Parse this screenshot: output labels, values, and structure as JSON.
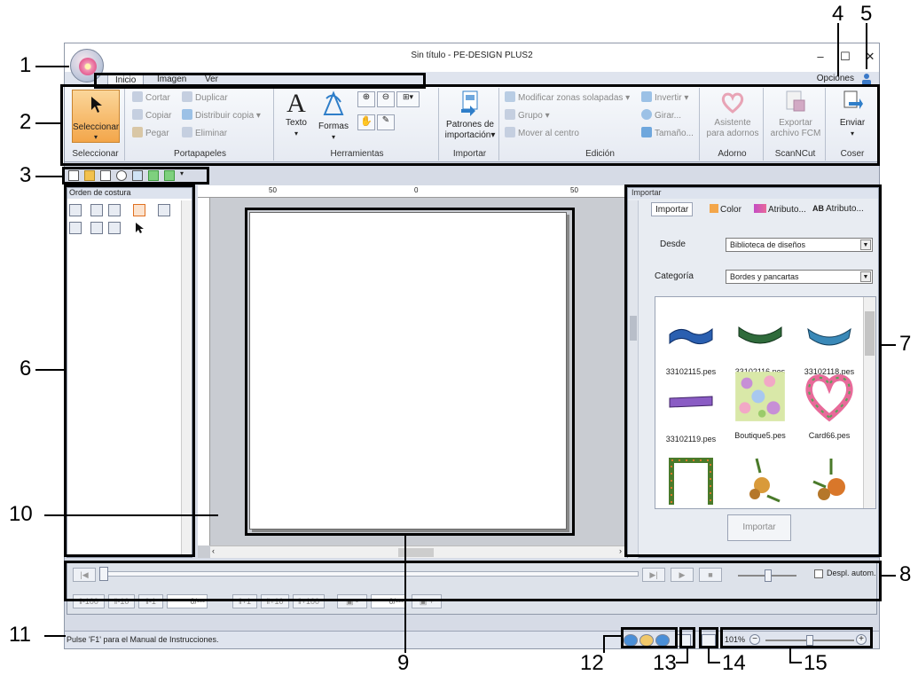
{
  "window": {
    "title": "Sin título - PE-DESIGN PLUS2",
    "min_glyph": "–",
    "max_glyph": "☐",
    "close_glyph": "✕"
  },
  "tabs": [
    {
      "label": "Inicio"
    },
    {
      "label": "Imagen"
    },
    {
      "label": "Ver"
    }
  ],
  "options_label": "Opciones",
  "ribbon": {
    "seleccionar": {
      "button": "Seleccionar",
      "group": "Seleccionar"
    },
    "portapapeles": {
      "group": "Portapapeles",
      "cut": "Cortar",
      "duplicate": "Duplicar",
      "copy": "Copiar",
      "distribute": "Distribuir copia",
      "paste": "Pegar",
      "delete": "Eliminar"
    },
    "herramientas": {
      "group": "Herramientas",
      "text": "Texto",
      "shapes": "Formas"
    },
    "importar": {
      "group": "Importar",
      "patterns_line1": "Patrones de",
      "patterns_line2": "importación"
    },
    "edicion": {
      "group": "Edición",
      "overlap": "Modificar zonas solapadas",
      "invert": "Invertir",
      "group_btn": "Grupo",
      "rotate": "Girar...",
      "center": "Mover al centro",
      "size": "Tamaño..."
    },
    "adorno": {
      "group": "Adorno",
      "line1": "Asistente",
      "line2": "para adornos"
    },
    "scanncut": {
      "group": "ScanNCut",
      "line1": "Exportar",
      "line2": "archivo FCM"
    },
    "coser": {
      "group": "Coser",
      "send": "Enviar"
    }
  },
  "left_panel": {
    "title": "Orden de costura"
  },
  "rulers": {
    "top": [
      "50",
      "0",
      "50"
    ]
  },
  "import_panel": {
    "title": "Importar",
    "tabs": [
      "Importar",
      "Color",
      "Atributo...",
      "Atributo..."
    ],
    "from_label": "Desde",
    "from_value": "Biblioteca de diseños",
    "category_label": "Categoría",
    "category_value": "Bordes y pancartas",
    "files": [
      "33102115.pes",
      "33102116.pes",
      "33102118.pes",
      "33102119.pes",
      "Boutique5.pes",
      "Card66.pes"
    ],
    "import_button": "Importar"
  },
  "playbar": {
    "auto_scroll": "Despl. autom.",
    "steps": [
      "-100",
      "-10",
      "-1",
      "+1",
      "+10",
      "+100"
    ],
    "counter1": "0",
    "counter2": "0",
    "counter_suffix": "/---"
  },
  "status": {
    "text": "Pulse 'F1' para el Manual de Instrucciones.",
    "zoom": "101%"
  },
  "callouts": [
    "1",
    "2",
    "3",
    "4",
    "5",
    "6",
    "7",
    "8",
    "9",
    "10",
    "11",
    "12",
    "13",
    "14",
    "15"
  ],
  "colors": {
    "accent_orange": "#f3a64a",
    "ribbon_bg": "#eef1f6",
    "callout": "#000000"
  }
}
